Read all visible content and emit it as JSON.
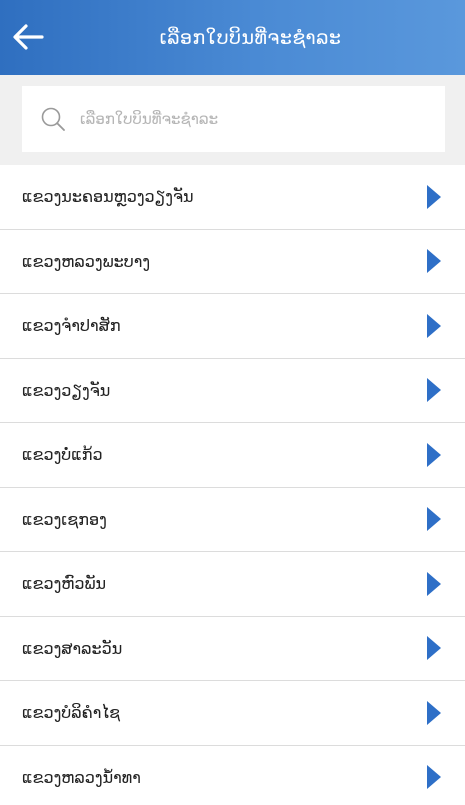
{
  "header": {
    "title": "ເລືອກໃບບິນທີ່ຈະຊຳລະ",
    "back_icon": "arrow-left-icon",
    "color_start": "#2f6fc0",
    "color_end": "#5a98dc"
  },
  "search": {
    "placeholder": "ເລືອກໃບບິນທີ່ຈະຊຳລະ",
    "value": "",
    "icon": "search-icon"
  },
  "list": {
    "arrow_color": "#2e6fc7",
    "items": [
      {
        "label": "ແຂວງນະຄອນຫຼວງວຽງຈັນ"
      },
      {
        "label": "ແຂວງຫລວງພະບາງ"
      },
      {
        "label": "ແຂວງຈຳປາສັກ"
      },
      {
        "label": "ແຂວງວຽງຈັນ"
      },
      {
        "label": "ແຂວງບໍ່ແກ້ວ"
      },
      {
        "label": "ແຂວງເຊກອງ"
      },
      {
        "label": "ແຂວງຫົວພັນ"
      },
      {
        "label": "ແຂວງສາລະວັນ"
      },
      {
        "label": "ແຂວງບໍລິຄຳໄຊ"
      },
      {
        "label": "ແຂວງຫລວງນ້ຳທາ"
      }
    ]
  }
}
